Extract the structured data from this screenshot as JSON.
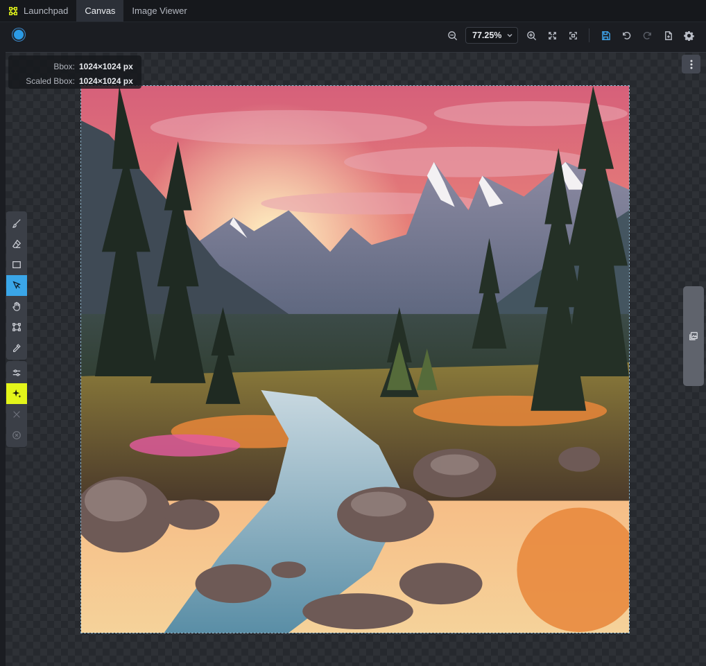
{
  "tabs": [
    {
      "label": "Launchpad",
      "icon": "launchpad-icon",
      "active": false
    },
    {
      "label": "Canvas",
      "icon": "",
      "active": true
    },
    {
      "label": "Image Viewer",
      "icon": "",
      "active": false
    }
  ],
  "toolbar": {
    "status_color": "#2b9be6",
    "zoom_value": "77.25%",
    "buttons": [
      "zoom-out-icon",
      "zoom-in-icon",
      "fit-icon",
      "fit-bbox-icon",
      "save-icon",
      "undo-icon",
      "redo-icon",
      "export-icon",
      "settings-icon"
    ]
  },
  "bbox_info": {
    "bbox_label": "Bbox:",
    "bbox_value": "1024×1024 px",
    "scaled_label": "Scaled Bbox:",
    "scaled_value": "1024×1024 px"
  },
  "tools": [
    {
      "name": "brush",
      "icon": "brush-icon",
      "active": false
    },
    {
      "name": "eraser",
      "icon": "eraser-icon",
      "active": false
    },
    {
      "name": "rectangle",
      "icon": "rectangle-icon",
      "active": false
    },
    {
      "name": "move",
      "icon": "cursor-icon",
      "active": true
    },
    {
      "name": "view",
      "icon": "hand-icon",
      "active": false
    },
    {
      "name": "bbox",
      "icon": "transform-icon",
      "active": false
    },
    {
      "name": "color-picker",
      "icon": "eyedropper-icon",
      "active": false
    }
  ],
  "tools2": [
    {
      "name": "adjust",
      "icon": "sliders-icon"
    },
    {
      "name": "invoke",
      "icon": "sparkle-icon"
    },
    {
      "name": "cancel",
      "icon": "close-icon"
    },
    {
      "name": "cancel-all",
      "icon": "circle-x-icon"
    }
  ],
  "colors": {
    "accent": "#3aa6e8",
    "invoke": "#e3f51a"
  }
}
